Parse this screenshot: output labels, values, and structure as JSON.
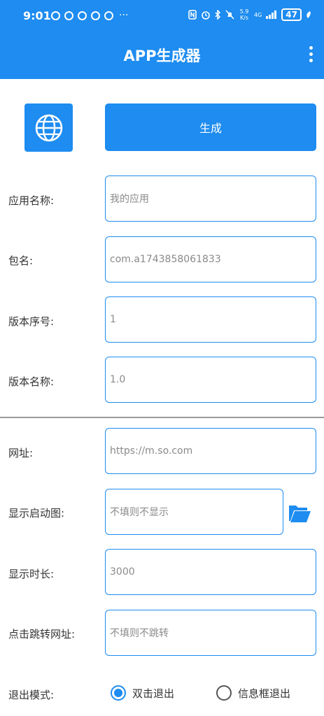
{
  "status_bar": {
    "time": "9:01",
    "more": "···",
    "network_speed": "5.9 K/s",
    "network_type": "4G",
    "battery": "47"
  },
  "app_bar": {
    "title": "APP生成器"
  },
  "actions": {
    "generate_label": "生成"
  },
  "form": {
    "app_name": {
      "label": "应用名称:",
      "value": "我的应用"
    },
    "package": {
      "label": "包名:",
      "value": "com.a1743858061833"
    },
    "version_code": {
      "label": "版本序号:",
      "value": "1"
    },
    "version_name": {
      "label": "版本名称:",
      "value": "1.0"
    },
    "url": {
      "label": "网址:",
      "value": "https://m.so.com"
    },
    "splash": {
      "label": "显示启动图:",
      "placeholder": "不填则不显示"
    },
    "duration": {
      "label": "显示时长:",
      "value": "3000"
    },
    "click_url": {
      "label": "点击跳转网址:",
      "placeholder": "不填则不跳转"
    },
    "exit_mode": {
      "label": "退出模式:",
      "options": [
        "双击退出",
        "信息框退出"
      ],
      "selected": "双击退出"
    }
  },
  "colors": {
    "primary": "#1e8cf0"
  }
}
